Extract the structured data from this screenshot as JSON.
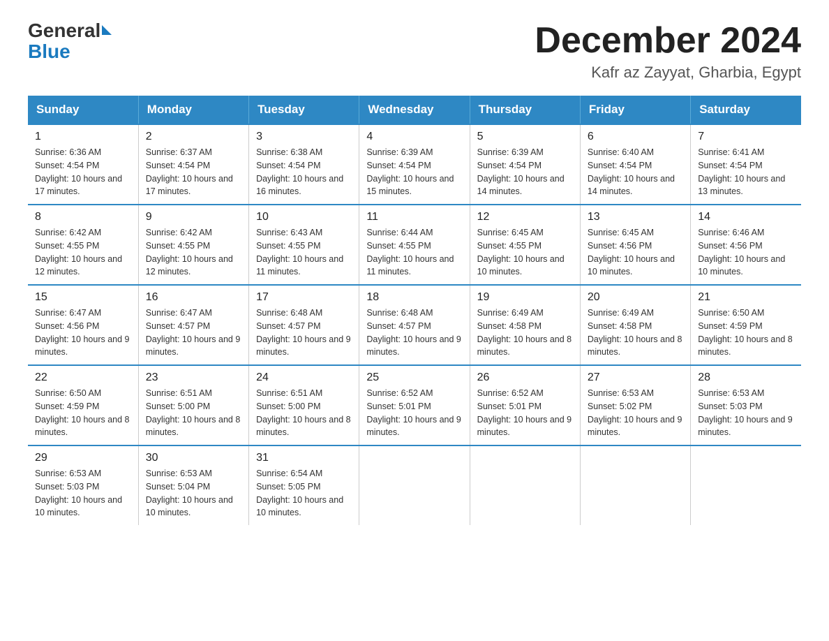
{
  "header": {
    "logo_text1": "General",
    "logo_text2": "Blue",
    "month_title": "December 2024",
    "location": "Kafr az Zayyat, Gharbia, Egypt"
  },
  "days_of_week": [
    "Sunday",
    "Monday",
    "Tuesday",
    "Wednesday",
    "Thursday",
    "Friday",
    "Saturday"
  ],
  "weeks": [
    [
      {
        "day": "1",
        "sunrise": "6:36 AM",
        "sunset": "4:54 PM",
        "daylight": "10 hours and 17 minutes."
      },
      {
        "day": "2",
        "sunrise": "6:37 AM",
        "sunset": "4:54 PM",
        "daylight": "10 hours and 17 minutes."
      },
      {
        "day": "3",
        "sunrise": "6:38 AM",
        "sunset": "4:54 PM",
        "daylight": "10 hours and 16 minutes."
      },
      {
        "day": "4",
        "sunrise": "6:39 AM",
        "sunset": "4:54 PM",
        "daylight": "10 hours and 15 minutes."
      },
      {
        "day": "5",
        "sunrise": "6:39 AM",
        "sunset": "4:54 PM",
        "daylight": "10 hours and 14 minutes."
      },
      {
        "day": "6",
        "sunrise": "6:40 AM",
        "sunset": "4:54 PM",
        "daylight": "10 hours and 14 minutes."
      },
      {
        "day": "7",
        "sunrise": "6:41 AM",
        "sunset": "4:54 PM",
        "daylight": "10 hours and 13 minutes."
      }
    ],
    [
      {
        "day": "8",
        "sunrise": "6:42 AM",
        "sunset": "4:55 PM",
        "daylight": "10 hours and 12 minutes."
      },
      {
        "day": "9",
        "sunrise": "6:42 AM",
        "sunset": "4:55 PM",
        "daylight": "10 hours and 12 minutes."
      },
      {
        "day": "10",
        "sunrise": "6:43 AM",
        "sunset": "4:55 PM",
        "daylight": "10 hours and 11 minutes."
      },
      {
        "day": "11",
        "sunrise": "6:44 AM",
        "sunset": "4:55 PM",
        "daylight": "10 hours and 11 minutes."
      },
      {
        "day": "12",
        "sunrise": "6:45 AM",
        "sunset": "4:55 PM",
        "daylight": "10 hours and 10 minutes."
      },
      {
        "day": "13",
        "sunrise": "6:45 AM",
        "sunset": "4:56 PM",
        "daylight": "10 hours and 10 minutes."
      },
      {
        "day": "14",
        "sunrise": "6:46 AM",
        "sunset": "4:56 PM",
        "daylight": "10 hours and 10 minutes."
      }
    ],
    [
      {
        "day": "15",
        "sunrise": "6:47 AM",
        "sunset": "4:56 PM",
        "daylight": "10 hours and 9 minutes."
      },
      {
        "day": "16",
        "sunrise": "6:47 AM",
        "sunset": "4:57 PM",
        "daylight": "10 hours and 9 minutes."
      },
      {
        "day": "17",
        "sunrise": "6:48 AM",
        "sunset": "4:57 PM",
        "daylight": "10 hours and 9 minutes."
      },
      {
        "day": "18",
        "sunrise": "6:48 AM",
        "sunset": "4:57 PM",
        "daylight": "10 hours and 9 minutes."
      },
      {
        "day": "19",
        "sunrise": "6:49 AM",
        "sunset": "4:58 PM",
        "daylight": "10 hours and 8 minutes."
      },
      {
        "day": "20",
        "sunrise": "6:49 AM",
        "sunset": "4:58 PM",
        "daylight": "10 hours and 8 minutes."
      },
      {
        "day": "21",
        "sunrise": "6:50 AM",
        "sunset": "4:59 PM",
        "daylight": "10 hours and 8 minutes."
      }
    ],
    [
      {
        "day": "22",
        "sunrise": "6:50 AM",
        "sunset": "4:59 PM",
        "daylight": "10 hours and 8 minutes."
      },
      {
        "day": "23",
        "sunrise": "6:51 AM",
        "sunset": "5:00 PM",
        "daylight": "10 hours and 8 minutes."
      },
      {
        "day": "24",
        "sunrise": "6:51 AM",
        "sunset": "5:00 PM",
        "daylight": "10 hours and 8 minutes."
      },
      {
        "day": "25",
        "sunrise": "6:52 AM",
        "sunset": "5:01 PM",
        "daylight": "10 hours and 9 minutes."
      },
      {
        "day": "26",
        "sunrise": "6:52 AM",
        "sunset": "5:01 PM",
        "daylight": "10 hours and 9 minutes."
      },
      {
        "day": "27",
        "sunrise": "6:53 AM",
        "sunset": "5:02 PM",
        "daylight": "10 hours and 9 minutes."
      },
      {
        "day": "28",
        "sunrise": "6:53 AM",
        "sunset": "5:03 PM",
        "daylight": "10 hours and 9 minutes."
      }
    ],
    [
      {
        "day": "29",
        "sunrise": "6:53 AM",
        "sunset": "5:03 PM",
        "daylight": "10 hours and 10 minutes."
      },
      {
        "day": "30",
        "sunrise": "6:53 AM",
        "sunset": "5:04 PM",
        "daylight": "10 hours and 10 minutes."
      },
      {
        "day": "31",
        "sunrise": "6:54 AM",
        "sunset": "5:05 PM",
        "daylight": "10 hours and 10 minutes."
      },
      null,
      null,
      null,
      null
    ]
  ]
}
